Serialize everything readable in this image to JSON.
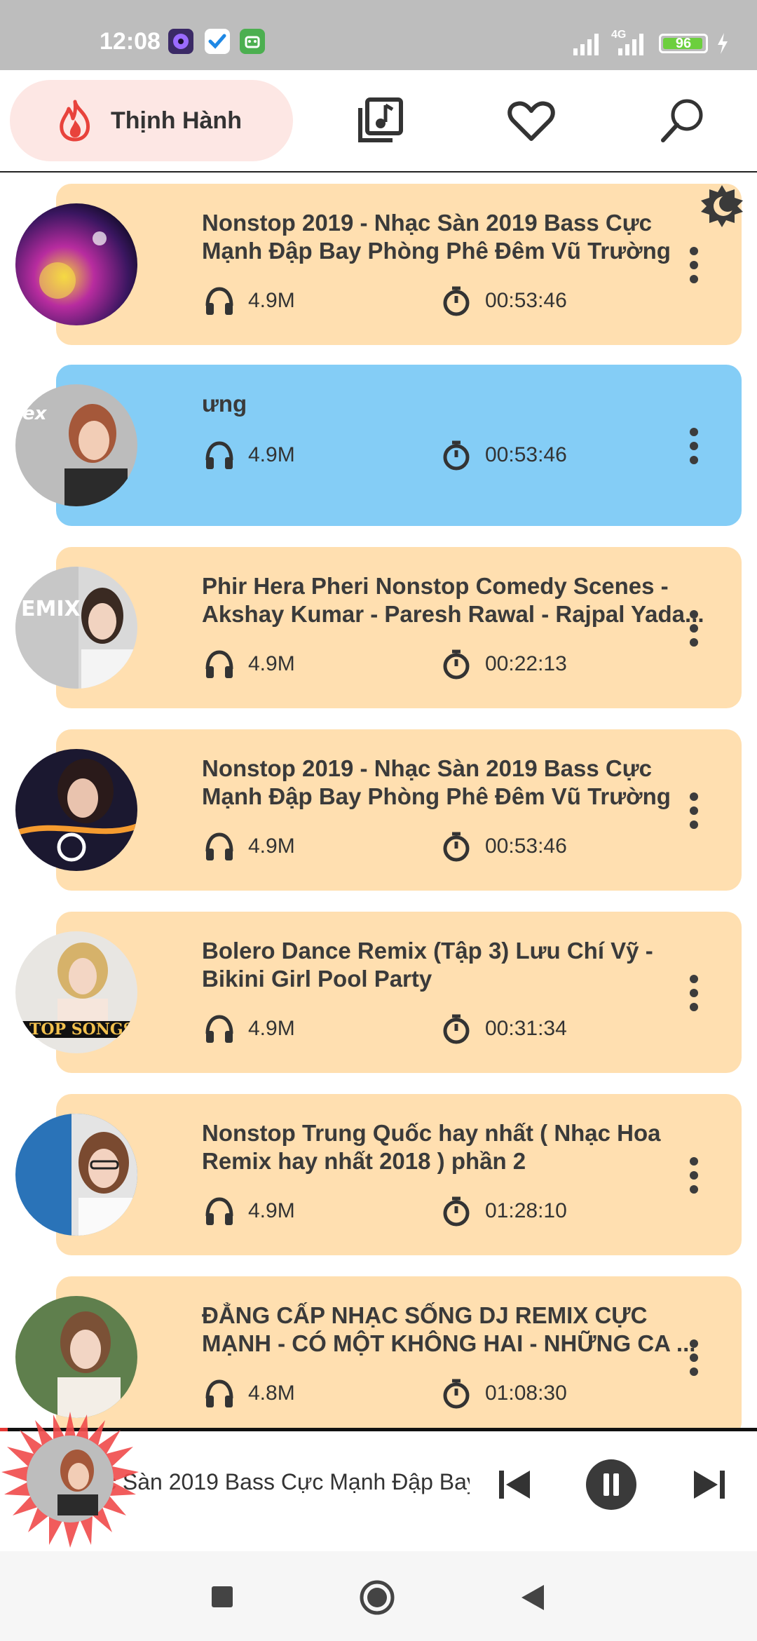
{
  "status_bar": {
    "time": "12:08",
    "battery": "96",
    "network": "4G",
    "icons": [
      "app-icon-music",
      "check-icon",
      "android-icon",
      "signal-icon",
      "signal-4g-icon",
      "battery-icon",
      "charging-icon"
    ]
  },
  "topnav": {
    "active_tab_label": "Thịnh Hành",
    "icons": [
      "flame-icon",
      "music-library-icon",
      "heart-icon",
      "search-icon"
    ],
    "accent": "#e8433c"
  },
  "songs": [
    {
      "title": "Nonstop 2019 - Nhạc Sàn 2019 Bass Cực Mạnh Đập Bay Phòng Phê Đêm Vũ Trường",
      "listens": "4.9M",
      "duration": "00:53:46",
      "active": false
    },
    {
      "title": "ưng",
      "listens": "4.9M",
      "duration": "00:53:46",
      "active": true
    },
    {
      "title": "Phir Hera Pheri Nonstop Comedy Scenes - Akshay Kumar - Paresh Rawal - Rajpal Yada...",
      "listens": "4.9M",
      "duration": "00:22:13",
      "active": false
    },
    {
      "title": "Nonstop 2019 - Nhạc Sàn 2019 Bass Cực Mạnh Đập Bay Phòng Phê Đêm Vũ Trường",
      "listens": "4.9M",
      "duration": "00:53:46",
      "active": false
    },
    {
      "title": "Bolero Dance Remix (Tập 3) Lưu Chí Vỹ - Bikini Girl Pool Party",
      "listens": "4.9M",
      "duration": "00:31:34",
      "active": false
    },
    {
      "title": "Nonstop Trung Quốc hay nhất ( Nhạc Hoa Remix hay nhất 2018 ) phần 2",
      "listens": "4.9M",
      "duration": "01:28:10",
      "active": false
    },
    {
      "title": "ĐẲNG CẤP NHẠC SỐNG DJ REMIX CỰC MẠNH - CÓ MỘT KHÔNG HAI - NHỮNG CA ...",
      "listens": "4.8M",
      "duration": "01:08:30",
      "active": false
    }
  ],
  "player": {
    "now_playing": "c Sàn 2019 Bass Cực Mạnh Đập Bay",
    "progress": 0.01,
    "icons": [
      "previous-icon",
      "pause-icon",
      "next-icon"
    ]
  },
  "colors": {
    "card_bg": "#ffdfb0",
    "active_card_bg": "#84cdf6",
    "tab_bg": "#fde7e4"
  }
}
